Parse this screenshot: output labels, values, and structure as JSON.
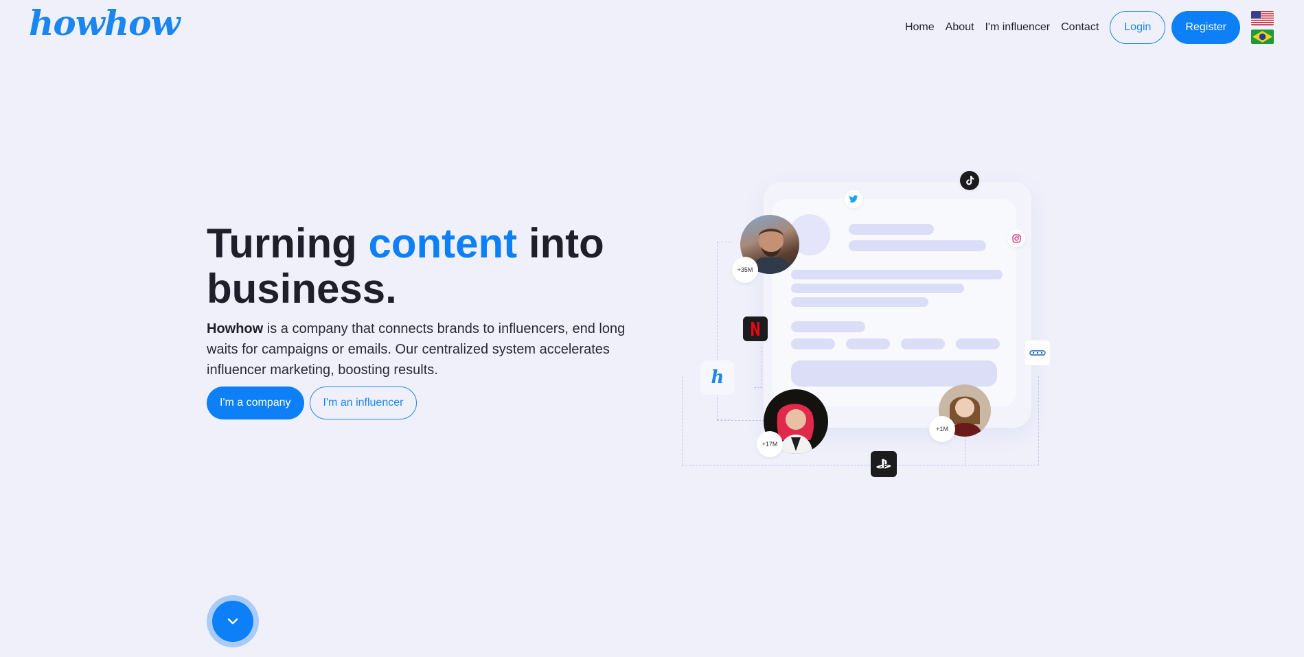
{
  "header": {
    "logo_text": "howhow",
    "nav": [
      "Home",
      "About",
      "I'm influencer",
      "Contact"
    ],
    "login_label": "Login",
    "register_label": "Register",
    "languages": [
      "en-US",
      "pt-BR"
    ]
  },
  "hero": {
    "title_before": "Turning ",
    "title_accent": "content",
    "title_after": " into business.",
    "desc_brand": "Howhow",
    "desc_text": " is a company that connects brands to influencers, end long waits for campaigns or emails. Our centralized system accelerates influencer marketing, boosting results.",
    "company_btn": "I'm a company",
    "influencer_btn": "I'm an influencer"
  },
  "illustration": {
    "followers": [
      "+35M",
      "+17M",
      "+1M"
    ],
    "brand_icons": [
      "twitter-icon",
      "tiktok-icon",
      "instagram-icon",
      "netflix-icon",
      "howhow-icon",
      "playstation-icon",
      "oreo-icon"
    ]
  },
  "colors": {
    "accent": "#0d7ff7",
    "background": "#eff0fa"
  }
}
